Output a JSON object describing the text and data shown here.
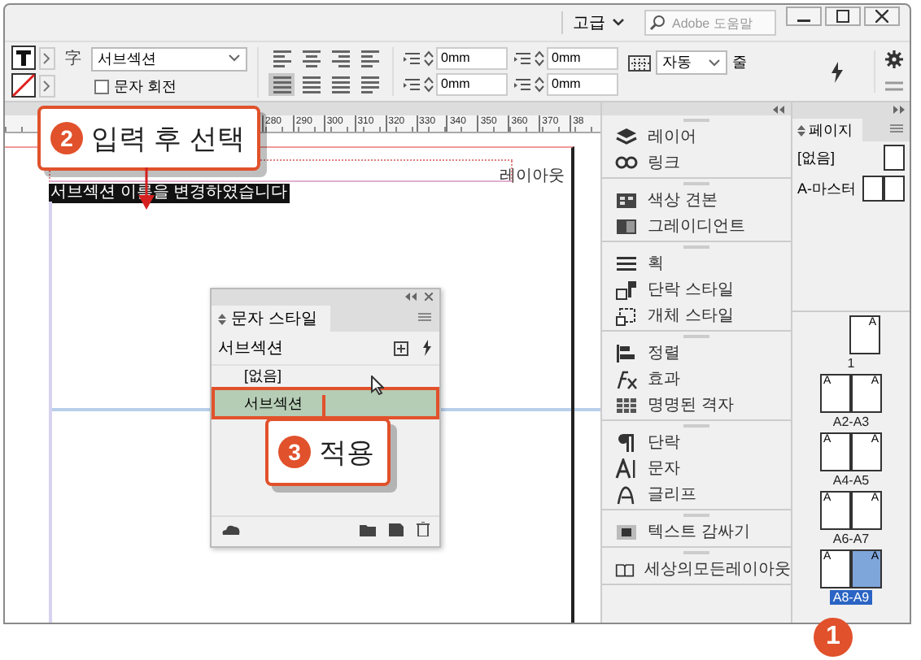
{
  "title_bar": {
    "workspace": "고급",
    "search_placeholder": "Adobe 도움말"
  },
  "control_bar": {
    "font_label": "字",
    "font_style": "서브섹션",
    "rotate": {
      "label": "문자 회전",
      "checked": false
    },
    "align_buttons": [
      {
        "selected": false
      },
      {
        "selected": false
      },
      {
        "selected": false
      },
      {
        "selected": false
      },
      {
        "selected": true
      },
      {
        "selected": false
      },
      {
        "selected": false
      },
      {
        "selected": false
      }
    ],
    "fields": [
      {
        "value": "0mm"
      },
      {
        "value": "0mm"
      },
      {
        "value": "0mm"
      },
      {
        "value": "0mm"
      }
    ],
    "grid_select": "자동",
    "grid_unit": "줄"
  },
  "ruler": {
    "labels": [
      "280",
      "290",
      "300",
      "310",
      "320",
      "330",
      "340",
      "350",
      "360",
      "370",
      "38"
    ]
  },
  "document": {
    "frame_label": "레이아웃",
    "selected_text": "서브섹션 이름을 변경하였습니다"
  },
  "callouts": [
    {
      "number": "2",
      "text": "입력 후 선택"
    },
    {
      "number": "3",
      "text": "적용"
    },
    {
      "number": "1"
    }
  ],
  "character_styles_panel": {
    "tab": "문자 스타일",
    "current": "서브섹션",
    "styles": [
      {
        "name": "[없음]",
        "selected": false
      },
      {
        "name": "서브섹션",
        "selected": true
      }
    ]
  },
  "panel_dock": {
    "groups": [
      [
        "레이어",
        "링크"
      ],
      [
        "색상 견본",
        "그레이디언트"
      ],
      [
        "획",
        "단락 스타일",
        "개체 스타일"
      ],
      [
        "정렬",
        "효과",
        "명명된 격자"
      ],
      [
        "단락",
        "문자",
        "글리프"
      ],
      [
        "텍스트 감싸기"
      ],
      [
        "세상의모든레이아웃"
      ]
    ]
  },
  "pages_panel": {
    "tab": "페이지",
    "masters": [
      {
        "name": "[없음]",
        "kind": "single"
      },
      {
        "name": "A-마스터",
        "kind": "spread"
      }
    ],
    "pages": [
      {
        "label": "1",
        "kind": "single",
        "selected": false,
        "letters": [
          "A"
        ]
      },
      {
        "label": "A2-A3",
        "kind": "spread",
        "selected": false,
        "letters": [
          "A",
          "A"
        ]
      },
      {
        "label": "A4-A5",
        "kind": "spread",
        "selected": false,
        "letters": [
          "A",
          "A"
        ]
      },
      {
        "label": "A6-A7",
        "kind": "spread",
        "selected": false,
        "letters": [
          "A",
          "A"
        ]
      },
      {
        "label": "A8-A9",
        "kind": "spread",
        "selected": true,
        "letters": [
          "A",
          "A"
        ]
      }
    ]
  }
}
